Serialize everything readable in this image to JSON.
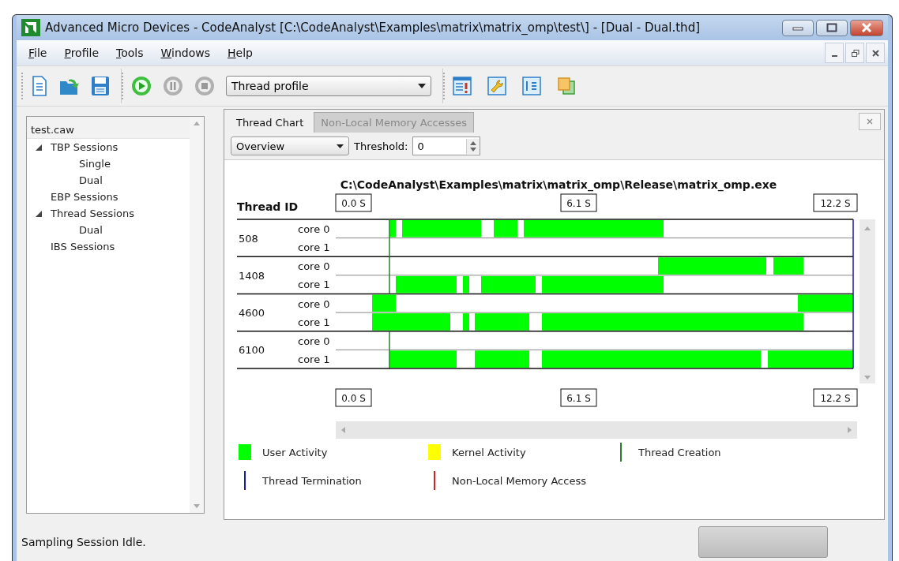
{
  "window": {
    "title": "Advanced Micro Devices - CodeAnalyst [C:\\CodeAnalyst\\Examples\\matrix\\matrix_omp\\test\\] - [Dual - Dual.thd]"
  },
  "menu": [
    {
      "label": "File"
    },
    {
      "label": "Profile"
    },
    {
      "label": "Tools"
    },
    {
      "label": "Windows"
    },
    {
      "label": "Help"
    }
  ],
  "toolbar": {
    "profile_type": "Thread profile"
  },
  "tree": {
    "root": "test.caw",
    "items": [
      {
        "label": "TBP Sessions",
        "expanded": true,
        "children": [
          {
            "label": "Single"
          },
          {
            "label": "Dual"
          }
        ]
      },
      {
        "label": "EBP Sessions"
      },
      {
        "label": "Thread Sessions",
        "expanded": true,
        "children": [
          {
            "label": "Dual"
          }
        ]
      },
      {
        "label": "IBS Sessions"
      }
    ]
  },
  "tabs": [
    {
      "label": "Thread Chart",
      "selected": true
    },
    {
      "label": "Non-Local Memory Accesses",
      "selected": false
    }
  ],
  "view": {
    "mode": "Overview",
    "threshold_label": "Threshold:",
    "threshold": "0"
  },
  "chart": {
    "title": "C:\\CodeAnalyst\\Examples\\matrix\\matrix_omp\\Release\\matrix_omp.exe",
    "column_header": "Thread ID",
    "time_marks_top": [
      "0.0 S",
      "6.1 S",
      "12.2 S"
    ],
    "time_marks_bottom": [
      "0.0 S",
      "6.1 S",
      "12.2 S"
    ],
    "threads": [
      {
        "id": "508",
        "cores": [
          "core 0",
          "core 1"
        ]
      },
      {
        "id": "1408",
        "cores": [
          "core 0",
          "core 1"
        ]
      },
      {
        "id": "4600",
        "cores": [
          "core 0",
          "core 1"
        ]
      },
      {
        "id": "6100",
        "cores": [
          "core 0",
          "core 1"
        ]
      }
    ]
  },
  "legend": [
    {
      "label": "User Activity",
      "kind": "swatch",
      "color": "#00ff00"
    },
    {
      "label": "Kernel Activity",
      "kind": "swatch",
      "color": "#ffff00"
    },
    {
      "label": "Thread Creation",
      "kind": "line",
      "color": "#2e7d32"
    },
    {
      "label": "Thread Termination",
      "kind": "line",
      "color": "#1a1aa0"
    },
    {
      "label": "Non-Local Memory Access",
      "kind": "line",
      "color": "#d32020"
    }
  ],
  "status_bar": {
    "message": "Sampling Session Idle.",
    "progress": {
      "level": 0
    }
  }
}
